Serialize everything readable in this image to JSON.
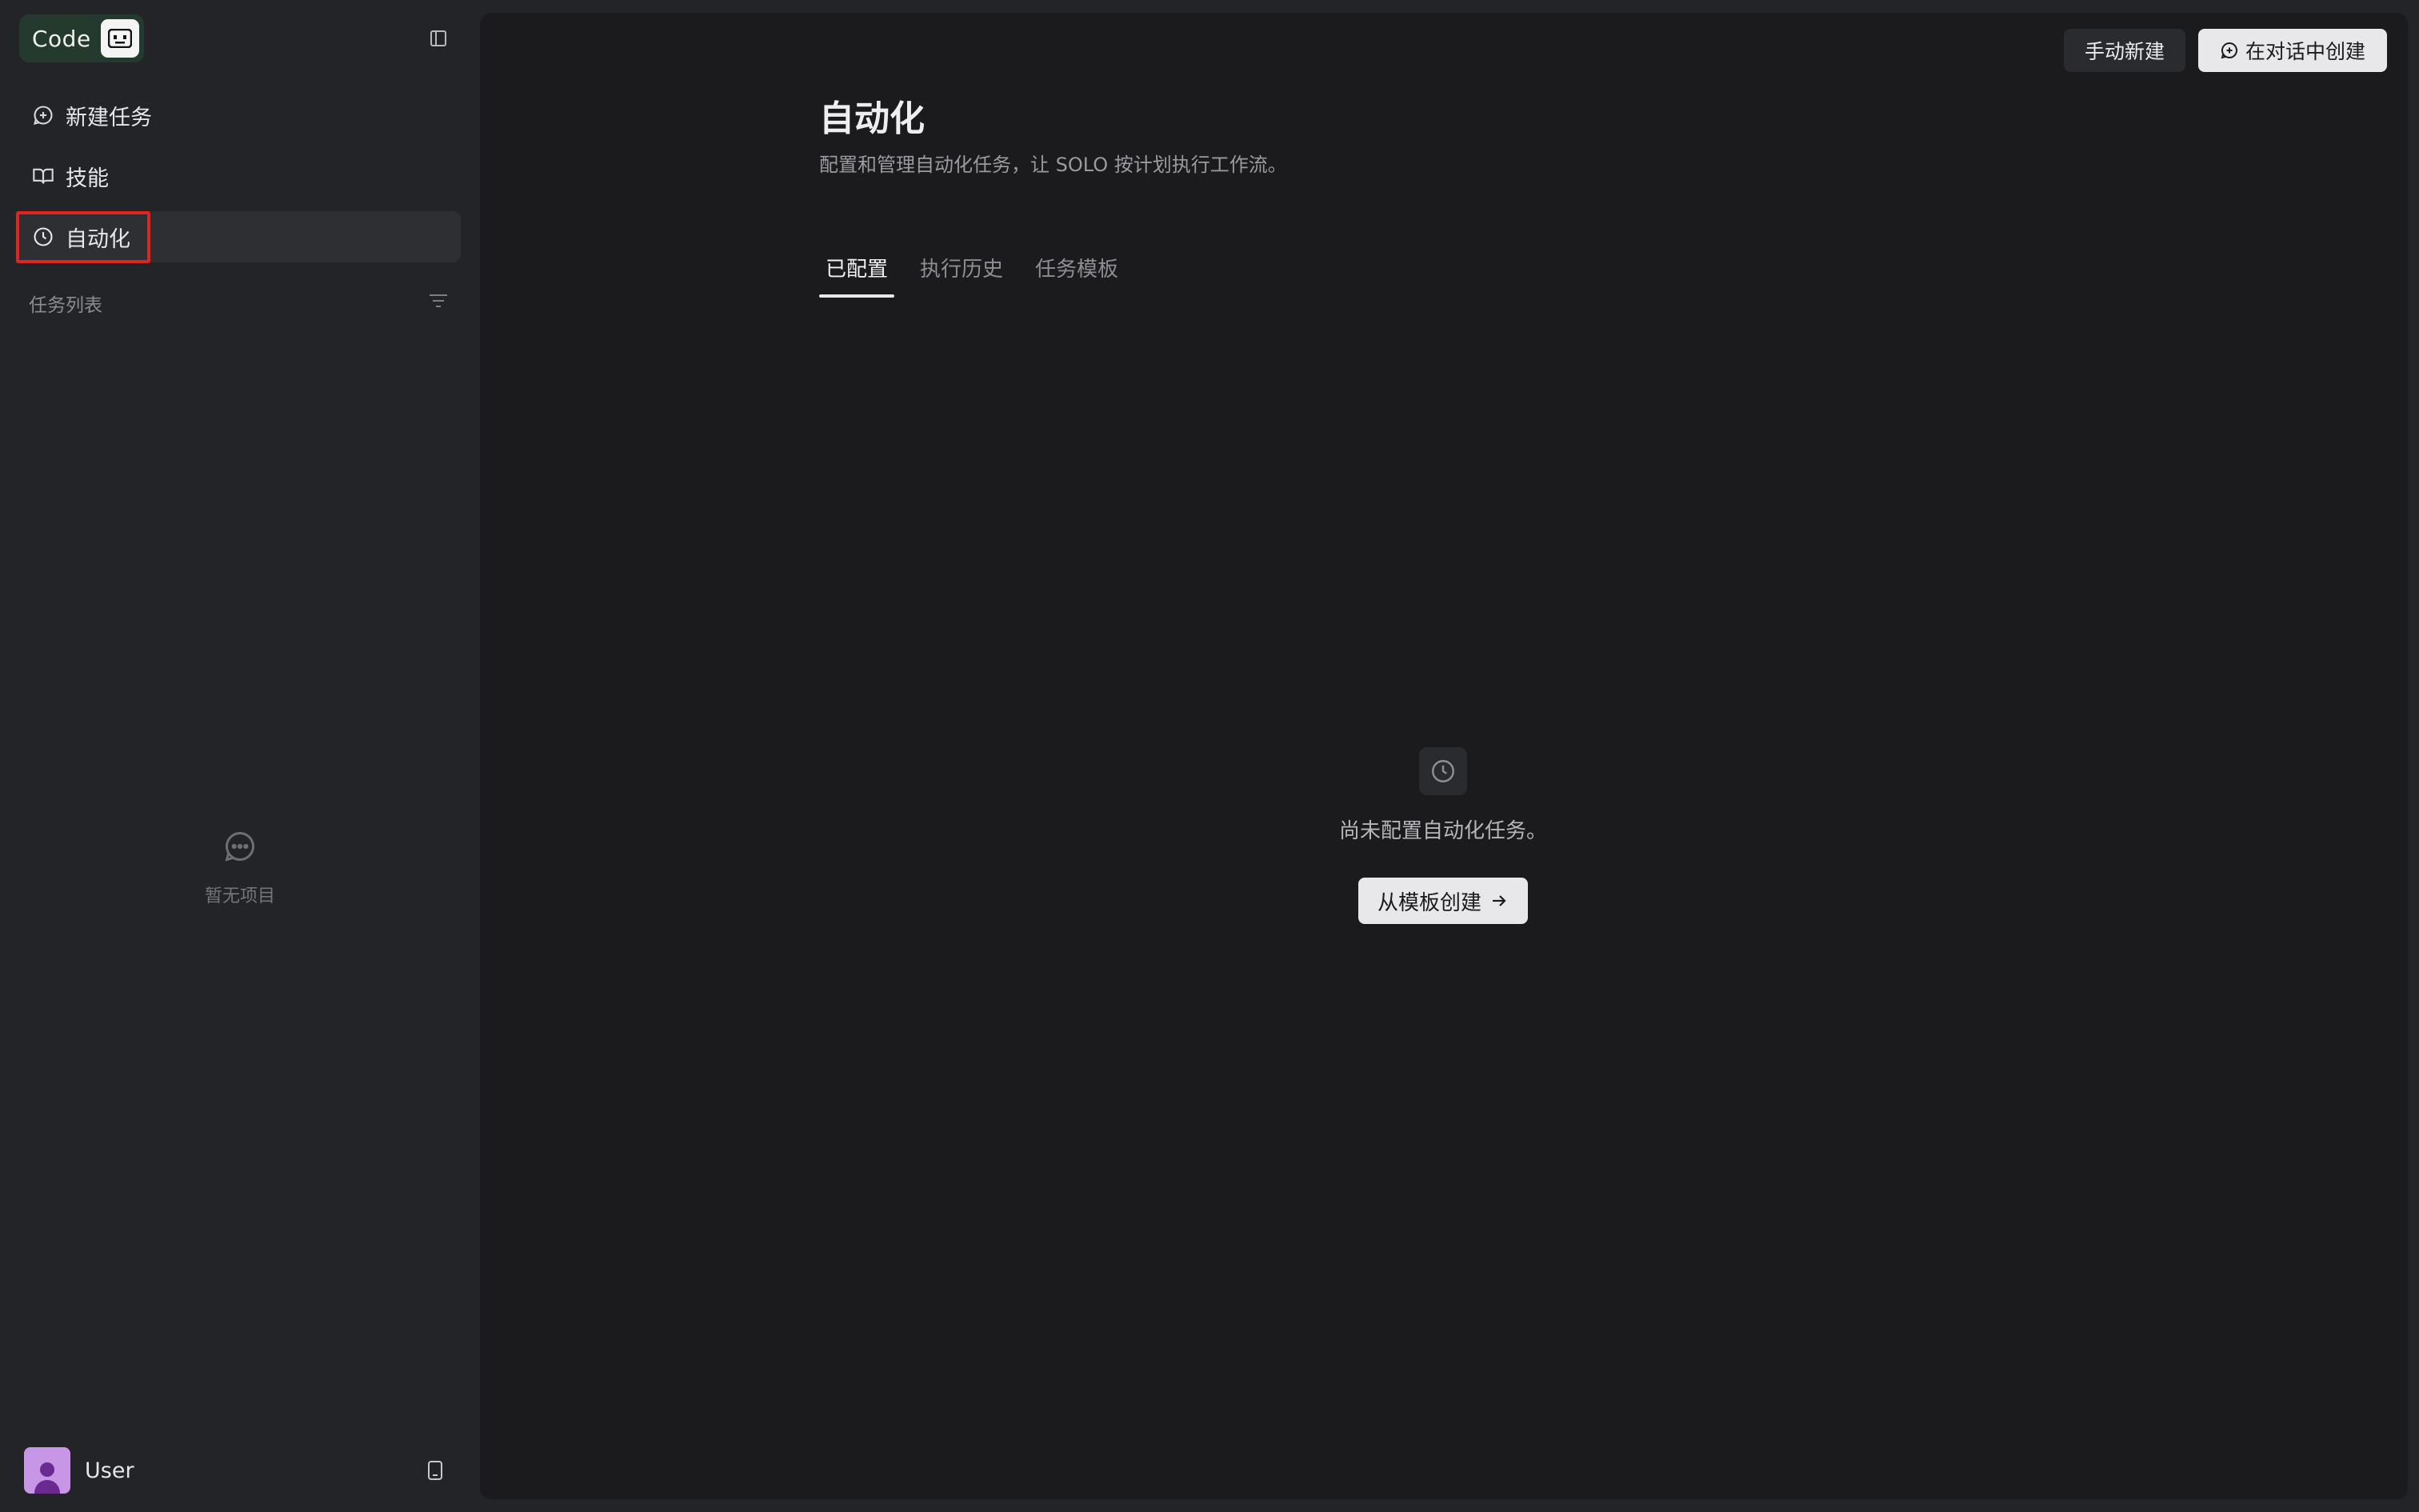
{
  "sidebar": {
    "logo_text": "Code",
    "nav": [
      {
        "label": "新建任务",
        "icon": "new-task-icon"
      },
      {
        "label": "技能",
        "icon": "book-icon"
      },
      {
        "label": "自动化",
        "icon": "clock-icon",
        "active": true
      }
    ],
    "section_title": "任务列表",
    "empty_text": "暂无项目",
    "user": {
      "name": "User"
    }
  },
  "header": {
    "manual_create_label": "手动新建",
    "chat_create_label": "在对话中创建"
  },
  "main": {
    "title": "自动化",
    "subtitle": "配置和管理自动化任务，让 SOLO 按计划执行工作流。",
    "tabs": [
      {
        "label": "已配置",
        "active": true
      },
      {
        "label": "执行历史"
      },
      {
        "label": "任务模板"
      }
    ],
    "empty_text": "尚未配置自动化任务。",
    "template_button_label": "从模板创建"
  },
  "colors": {
    "sidebar_bg": "#232427",
    "main_bg": "#1b1b1d",
    "logo_bg": "#243a2e",
    "highlight": "#e0241f",
    "avatar": "#c896e6"
  }
}
